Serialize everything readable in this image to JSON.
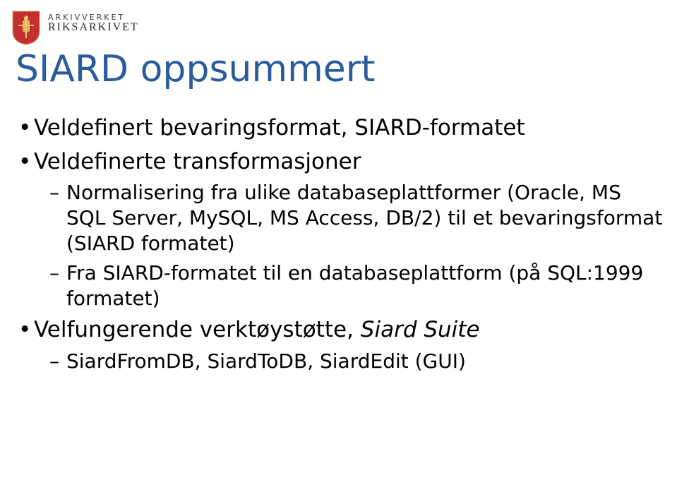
{
  "logo": {
    "line1": "ARKIVVERKET",
    "line2": "RIKSARKIVET"
  },
  "title": "SIARD oppsummert",
  "bullets": [
    {
      "text": "Veldefinert bevaringsformat, SIARD-formatet",
      "children": []
    },
    {
      "text": "Veldefinerte transformasjoner",
      "children": [
        {
          "text": "Normalisering fra ulike databaseplattformer (Oracle, MS SQL Server, MySQL, MS Access, DB/2) til et bevaringsformat (SIARD formatet)"
        },
        {
          "text": "Fra SIARD-formatet til en databaseplattform (på SQL:1999 formatet)"
        }
      ]
    },
    {
      "text": "Velfungerende verktøystøtte, ",
      "italicSuffix": "Siard Suite",
      "children": [
        {
          "text": "SiardFromDB, SiardToDB, SiardEdit (GUI)"
        }
      ]
    }
  ]
}
